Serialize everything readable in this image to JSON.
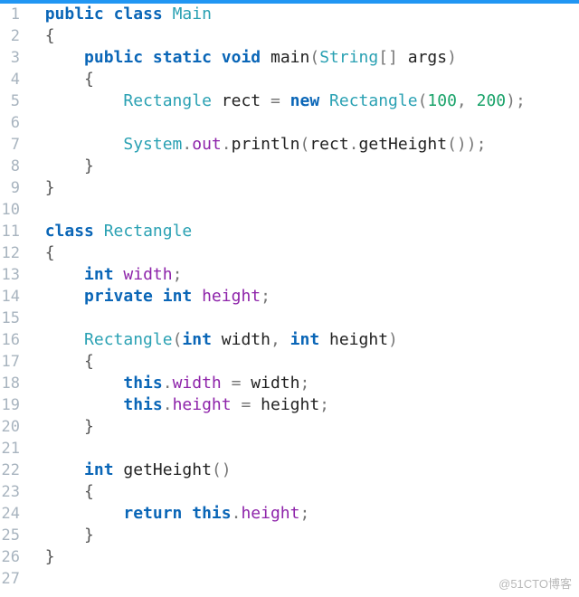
{
  "topbar_color": "#2196f3",
  "watermark": "@51CTO博客",
  "lines": [
    {
      "n": 1,
      "tokens": [
        [
          "sp",
          "  "
        ],
        [
          "kw",
          "public"
        ],
        [
          "sp",
          " "
        ],
        [
          "kw",
          "class"
        ],
        [
          "sp",
          " "
        ],
        [
          "type",
          "Main"
        ]
      ]
    },
    {
      "n": 2,
      "tokens": [
        [
          "sp",
          "  "
        ],
        [
          "brace",
          "{"
        ]
      ]
    },
    {
      "n": 3,
      "tokens": [
        [
          "sp",
          "      "
        ],
        [
          "kw",
          "public"
        ],
        [
          "sp",
          " "
        ],
        [
          "kw",
          "static"
        ],
        [
          "sp",
          " "
        ],
        [
          "kw",
          "void"
        ],
        [
          "sp",
          " "
        ],
        [
          "ident",
          "main"
        ],
        [
          "punct",
          "("
        ],
        [
          "type",
          "String"
        ],
        [
          "punct",
          "[]"
        ],
        [
          "sp",
          " "
        ],
        [
          "ident",
          "args"
        ],
        [
          "punct",
          ")"
        ]
      ]
    },
    {
      "n": 4,
      "tokens": [
        [
          "sp",
          "      "
        ],
        [
          "brace",
          "{"
        ]
      ]
    },
    {
      "n": 5,
      "tokens": [
        [
          "sp",
          "          "
        ],
        [
          "type",
          "Rectangle"
        ],
        [
          "sp",
          " "
        ],
        [
          "ident",
          "rect"
        ],
        [
          "sp",
          " "
        ],
        [
          "punct",
          "="
        ],
        [
          "sp",
          " "
        ],
        [
          "kw",
          "new"
        ],
        [
          "sp",
          " "
        ],
        [
          "type",
          "Rectangle"
        ],
        [
          "punct",
          "("
        ],
        [
          "num",
          "100"
        ],
        [
          "punct",
          ","
        ],
        [
          "sp",
          " "
        ],
        [
          "num",
          "200"
        ],
        [
          "punct",
          ")"
        ],
        [
          "punct",
          ";"
        ]
      ]
    },
    {
      "n": 6,
      "tokens": []
    },
    {
      "n": 7,
      "tokens": [
        [
          "sp",
          "          "
        ],
        [
          "type",
          "System"
        ],
        [
          "punct",
          "."
        ],
        [
          "field",
          "out"
        ],
        [
          "punct",
          "."
        ],
        [
          "ident",
          "println"
        ],
        [
          "punct",
          "("
        ],
        [
          "ident",
          "rect"
        ],
        [
          "punct",
          "."
        ],
        [
          "ident",
          "getHeight"
        ],
        [
          "punct",
          "("
        ],
        [
          "punct",
          ")"
        ],
        [
          "punct",
          ")"
        ],
        [
          "punct",
          ";"
        ]
      ]
    },
    {
      "n": 8,
      "tokens": [
        [
          "sp",
          "      "
        ],
        [
          "brace",
          "}"
        ]
      ]
    },
    {
      "n": 9,
      "tokens": [
        [
          "sp",
          "  "
        ],
        [
          "brace",
          "}"
        ]
      ]
    },
    {
      "n": 10,
      "tokens": []
    },
    {
      "n": 11,
      "tokens": [
        [
          "sp",
          "  "
        ],
        [
          "kw",
          "class"
        ],
        [
          "sp",
          " "
        ],
        [
          "type",
          "Rectangle"
        ]
      ]
    },
    {
      "n": 12,
      "tokens": [
        [
          "sp",
          "  "
        ],
        [
          "brace",
          "{"
        ]
      ]
    },
    {
      "n": 13,
      "tokens": [
        [
          "sp",
          "      "
        ],
        [
          "kw",
          "int"
        ],
        [
          "sp",
          " "
        ],
        [
          "field",
          "width"
        ],
        [
          "punct",
          ";"
        ]
      ]
    },
    {
      "n": 14,
      "tokens": [
        [
          "sp",
          "      "
        ],
        [
          "kw",
          "private"
        ],
        [
          "sp",
          " "
        ],
        [
          "kw",
          "int"
        ],
        [
          "sp",
          " "
        ],
        [
          "field",
          "height"
        ],
        [
          "punct",
          ";"
        ]
      ]
    },
    {
      "n": 15,
      "tokens": []
    },
    {
      "n": 16,
      "tokens": [
        [
          "sp",
          "      "
        ],
        [
          "type",
          "Rectangle"
        ],
        [
          "punct",
          "("
        ],
        [
          "kw",
          "int"
        ],
        [
          "sp",
          " "
        ],
        [
          "ident",
          "width"
        ],
        [
          "punct",
          ","
        ],
        [
          "sp",
          " "
        ],
        [
          "kw",
          "int"
        ],
        [
          "sp",
          " "
        ],
        [
          "ident",
          "height"
        ],
        [
          "punct",
          ")"
        ]
      ]
    },
    {
      "n": 17,
      "tokens": [
        [
          "sp",
          "      "
        ],
        [
          "brace",
          "{"
        ]
      ]
    },
    {
      "n": 18,
      "tokens": [
        [
          "sp",
          "          "
        ],
        [
          "kw",
          "this"
        ],
        [
          "punct",
          "."
        ],
        [
          "field",
          "width"
        ],
        [
          "sp",
          " "
        ],
        [
          "punct",
          "="
        ],
        [
          "sp",
          " "
        ],
        [
          "ident",
          "width"
        ],
        [
          "punct",
          ";"
        ]
      ]
    },
    {
      "n": 19,
      "tokens": [
        [
          "sp",
          "          "
        ],
        [
          "kw",
          "this"
        ],
        [
          "punct",
          "."
        ],
        [
          "field",
          "height"
        ],
        [
          "sp",
          " "
        ],
        [
          "punct",
          "="
        ],
        [
          "sp",
          " "
        ],
        [
          "ident",
          "height"
        ],
        [
          "punct",
          ";"
        ]
      ]
    },
    {
      "n": 20,
      "tokens": [
        [
          "sp",
          "      "
        ],
        [
          "brace",
          "}"
        ]
      ]
    },
    {
      "n": 21,
      "tokens": []
    },
    {
      "n": 22,
      "tokens": [
        [
          "sp",
          "      "
        ],
        [
          "kw",
          "int"
        ],
        [
          "sp",
          " "
        ],
        [
          "ident",
          "getHeight"
        ],
        [
          "punct",
          "("
        ],
        [
          "punct",
          ")"
        ]
      ]
    },
    {
      "n": 23,
      "tokens": [
        [
          "sp",
          "      "
        ],
        [
          "brace",
          "{"
        ]
      ]
    },
    {
      "n": 24,
      "tokens": [
        [
          "sp",
          "          "
        ],
        [
          "kw",
          "return"
        ],
        [
          "sp",
          " "
        ],
        [
          "kw",
          "this"
        ],
        [
          "punct",
          "."
        ],
        [
          "field",
          "height"
        ],
        [
          "punct",
          ";"
        ]
      ]
    },
    {
      "n": 25,
      "tokens": [
        [
          "sp",
          "      "
        ],
        [
          "brace",
          "}"
        ]
      ]
    },
    {
      "n": 26,
      "tokens": [
        [
          "sp",
          "  "
        ],
        [
          "brace",
          "}"
        ]
      ]
    },
    {
      "n": 27,
      "tokens": []
    }
  ]
}
